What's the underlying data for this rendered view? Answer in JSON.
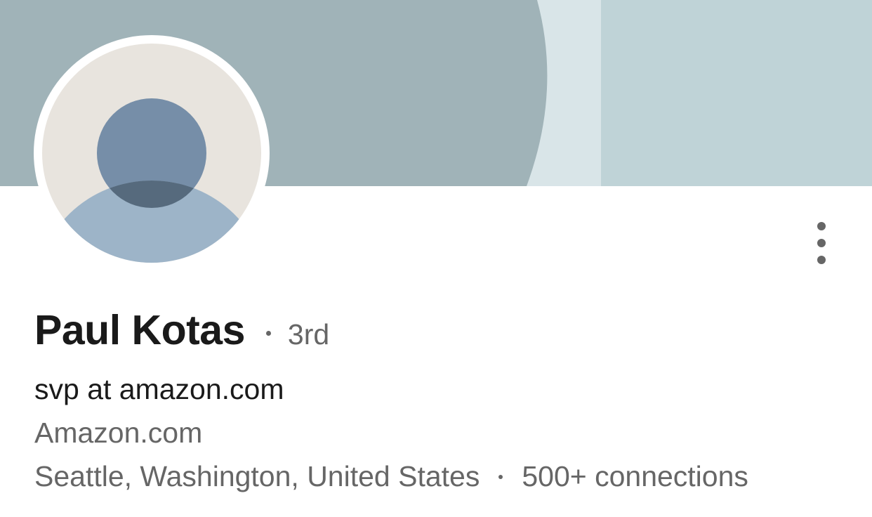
{
  "cover": {
    "colors": {
      "band_left": "#a0b3b8",
      "band_middle": "#d9e5e8",
      "band_right": "#bfd3d7"
    }
  },
  "avatar": {
    "icon": "default-person-silhouette",
    "colors": {
      "background": "#e8e4de",
      "head": "#768ea8",
      "body": "#9db4c8",
      "overlap": "#566a7d"
    }
  },
  "actions": {
    "more_icon": "vertical-ellipsis-icon"
  },
  "profile": {
    "name": "Paul Kotas",
    "degree": "3rd",
    "headline": "svp at amazon.com",
    "company": "Amazon.com",
    "location": "Seattle, Washington, United States",
    "connections": "500+ connections"
  }
}
